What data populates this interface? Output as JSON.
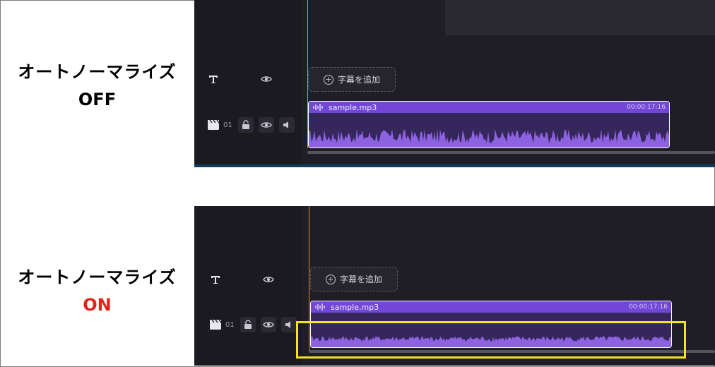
{
  "labels": {
    "feature": "オートノーマライズ",
    "off": "OFF",
    "on": "ON",
    "off_color": "#000000",
    "on_color": "#e2231a"
  },
  "timeline": {
    "subtitle_button": "字幕を追加",
    "track_number": "01",
    "clip_name": "sample.mp3",
    "clip_duration": "00:00:17:16"
  },
  "colors": {
    "clip_header": "#7247d8",
    "waveform": "#8d62e0",
    "playhead": "#d9962d",
    "highlight": "#f3e222"
  },
  "icons": [
    "text-icon",
    "eye-icon",
    "clapper-icon",
    "unlock-icon",
    "speaker-icon",
    "audio-wave-icon",
    "plus-circle-icon"
  ]
}
